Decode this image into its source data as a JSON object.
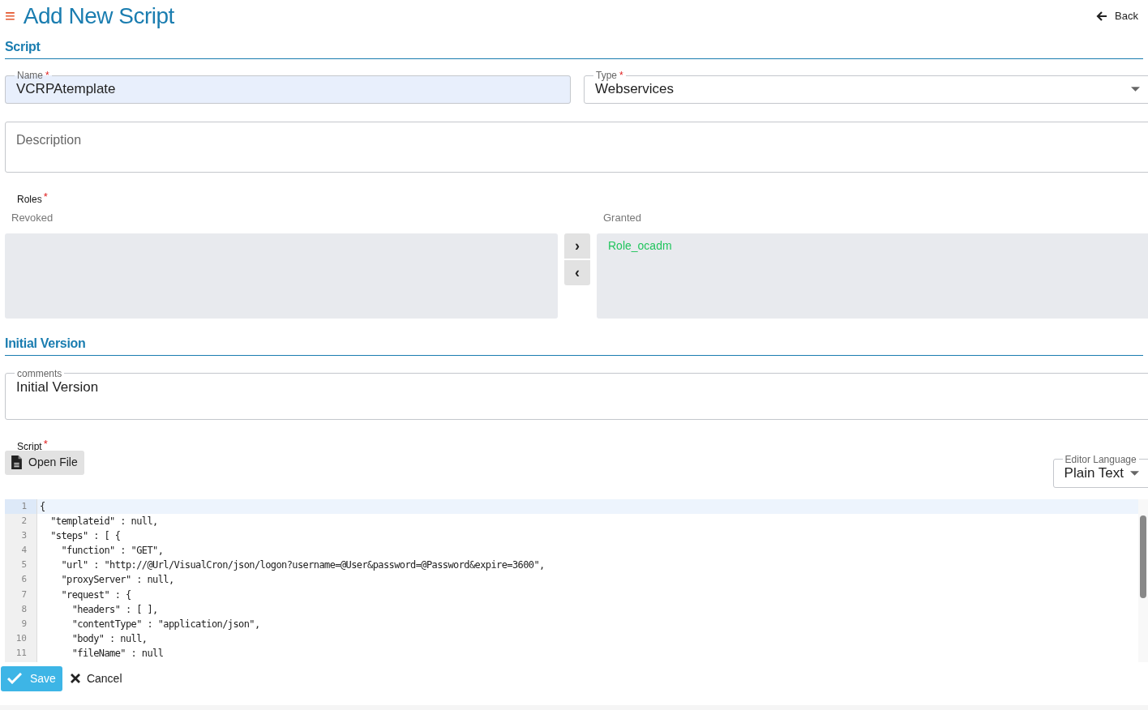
{
  "header": {
    "menu_icon": "≡",
    "title": "Add New Script",
    "back": "Back"
  },
  "script_section": {
    "heading": "Script",
    "name": {
      "label": "Name",
      "required_mark": "*",
      "value": "VCRPAtemplate"
    },
    "type": {
      "label": "Type",
      "required_mark": "*",
      "value": "Webservices"
    },
    "description": {
      "placeholder": "Description"
    },
    "roles": {
      "label": "Roles",
      "required_mark": "*",
      "revoked_label": "Revoked",
      "granted_label": "Granted",
      "granted": [
        "Role_ocadm"
      ],
      "move_right": "›",
      "move_left": "‹"
    }
  },
  "initial_version": {
    "heading": "Initial Version",
    "comments": {
      "label": "comments",
      "value": "Initial Version"
    },
    "script": {
      "label": "Script",
      "required_mark": "*",
      "open_file": "Open File"
    },
    "editor_language": {
      "label": "Editor Language",
      "value": "Plain Text"
    },
    "editor_lines": [
      {
        "number": "1",
        "text": "{",
        "current": true
      },
      {
        "number": "2",
        "text": "  \"templateid\" : null,",
        "current": false
      },
      {
        "number": "3",
        "text": "  \"steps\" : [ {",
        "current": false
      },
      {
        "number": "4",
        "text": "    \"function\" : \"GET\",",
        "current": false
      },
      {
        "number": "5",
        "text": "    \"url\" : \"http://@Url/VisualCron/json/logon?username=@User&password=@Password&expire=3600\",",
        "current": false
      },
      {
        "number": "6",
        "text": "    \"proxyServer\" : null,",
        "current": false
      },
      {
        "number": "7",
        "text": "    \"request\" : {",
        "current": false
      },
      {
        "number": "8",
        "text": "      \"headers\" : [ ],",
        "current": false
      },
      {
        "number": "9",
        "text": "      \"contentType\" : \"application/json\",",
        "current": false
      },
      {
        "number": "10",
        "text": "      \"body\" : null,",
        "current": false
      },
      {
        "number": "11",
        "text": "      \"fileName\" : null",
        "current": false
      }
    ]
  },
  "footer": {
    "save": "Save",
    "cancel": "Cancel"
  }
}
